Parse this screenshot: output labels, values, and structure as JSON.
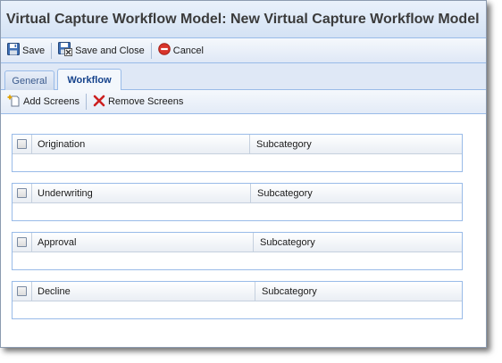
{
  "window": {
    "title": "Virtual Capture Workflow Model: New Virtual Capture Workflow Model"
  },
  "toolbar": {
    "save_label": "Save",
    "save_close_label": "Save and Close",
    "cancel_label": "Cancel"
  },
  "tabs": [
    {
      "label": "General",
      "active": false
    },
    {
      "label": "Workflow",
      "active": true
    }
  ],
  "workflow_toolbar": {
    "add_label": "Add Screens",
    "remove_label": "Remove Screens"
  },
  "grids": [
    {
      "name": "Origination",
      "subcategory_header": "Subcategory"
    },
    {
      "name": "Underwriting",
      "subcategory_header": "Subcategory"
    },
    {
      "name": "Approval",
      "subcategory_header": "Subcategory"
    },
    {
      "name": "Decline",
      "subcategory_header": "Subcategory"
    }
  ],
  "icons": {
    "save": "floppy-disk-icon",
    "save_close": "floppy-disk-close-icon",
    "cancel": "cancel-circle-icon",
    "add": "add-page-icon",
    "remove": "red-x-icon"
  },
  "colors": {
    "accent_border": "#99bbe8",
    "tab_active_text": "#15428b",
    "cancel_red": "#d9342b",
    "remove_red": "#cc1f1f"
  }
}
